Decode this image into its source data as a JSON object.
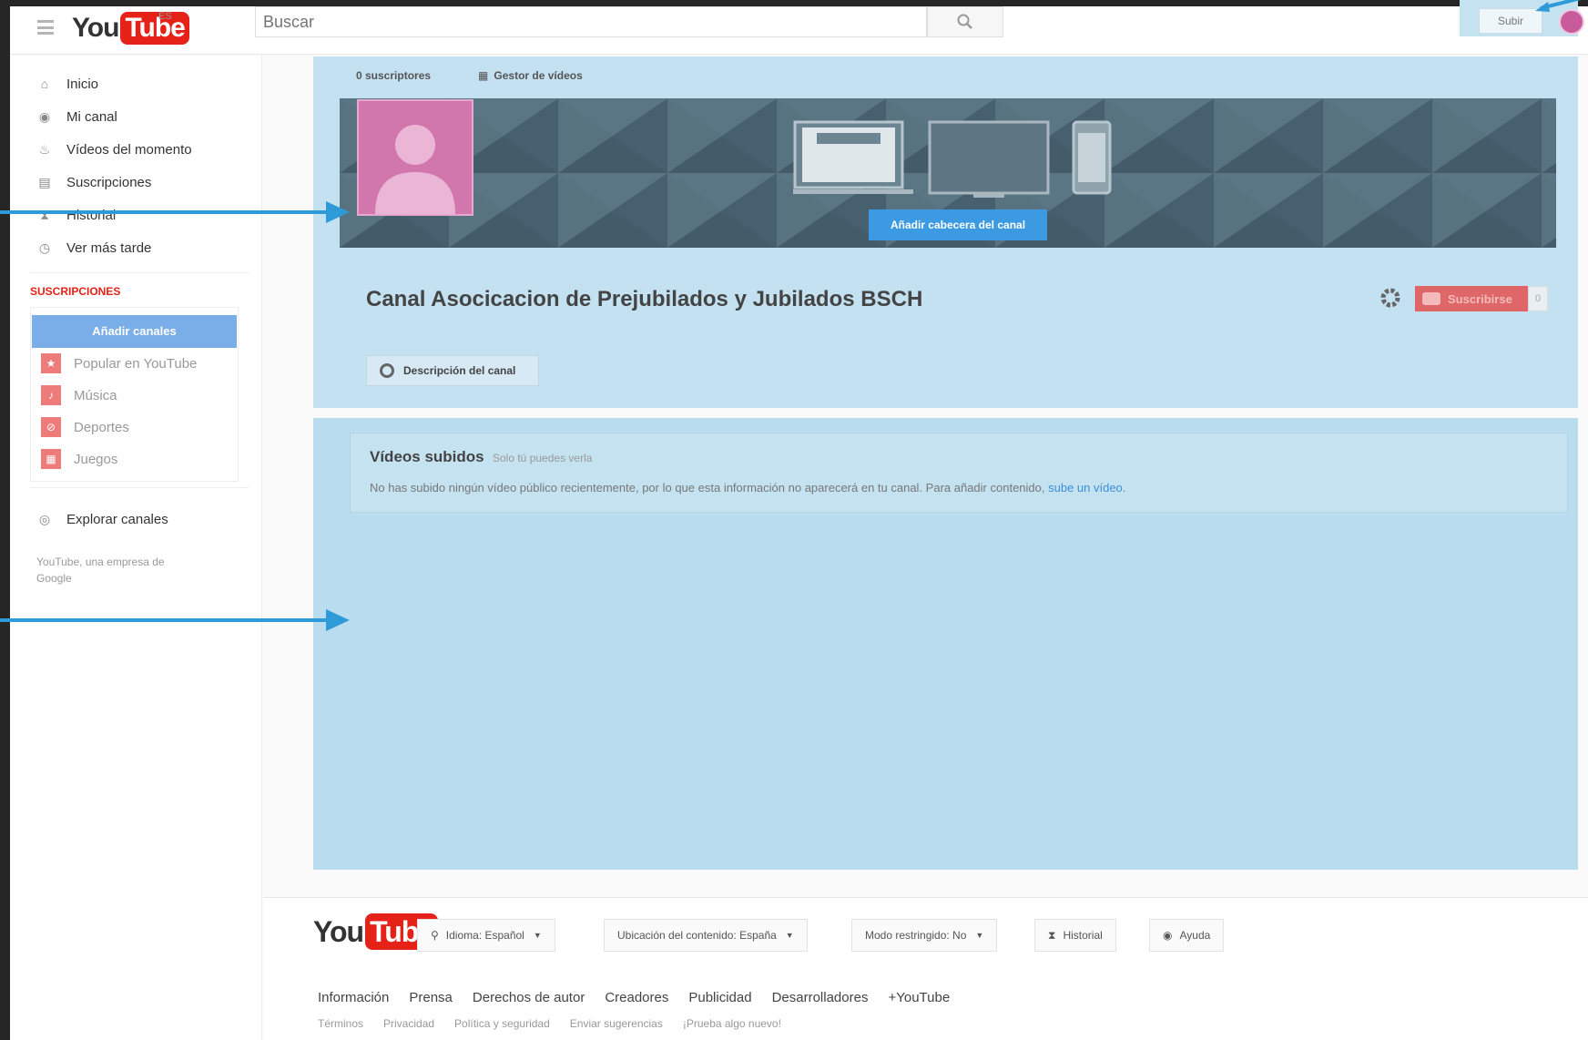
{
  "header": {
    "logo_you": "You",
    "logo_tube": "Tube",
    "locale": "ES",
    "search_placeholder": "Buscar",
    "upload_label": "Subir"
  },
  "sidebar": {
    "nav": [
      {
        "label": "Inicio",
        "icon": "home-icon"
      },
      {
        "label": "Mi canal",
        "icon": "user-icon"
      },
      {
        "label": "Vídeos del momento",
        "icon": "flame-icon"
      },
      {
        "label": "Suscripciones",
        "icon": "subscriptions-icon"
      },
      {
        "label": "Historial",
        "icon": "hourglass-icon"
      },
      {
        "label": "Ver más tarde",
        "icon": "clock-icon"
      }
    ],
    "subscriptions_header": "SUSCRIPCIONES",
    "add_channels_label": "Añadir canales",
    "subscriptions": [
      {
        "label": "Popular en YouTube",
        "icon": "star-icon"
      },
      {
        "label": "Música",
        "icon": "music-icon"
      },
      {
        "label": "Deportes",
        "icon": "sports-icon"
      },
      {
        "label": "Juegos",
        "icon": "gamepad-icon"
      }
    ],
    "explore_label": "Explorar canales",
    "footer_text": "YouTube, una empresa de Google"
  },
  "channel": {
    "tabs": {
      "subscribers": "0 suscriptores",
      "video_manager": "Gestor de vídeos"
    },
    "add_header_label": "Añadir cabecera del canal",
    "title": "Canal Asocicacion de Prejubilados y Jubilados BSCH",
    "subscribe_label": "Suscribirse",
    "subscriber_count": "0",
    "description_label": "Descripción del canal",
    "uploaded_title": "Vídeos subidos",
    "uploaded_visibility": "Solo tú puedes verla",
    "uploaded_message": "No has subido ningún vídeo público recientemente, por lo que esta información no aparecerá en tu canal. Para añadir contenido, ",
    "uploaded_link": "sube un vídeo",
    "uploaded_end": "."
  },
  "footer": {
    "language": "Idioma: Español",
    "location": "Ubicación del contenido: España",
    "restricted": "Modo restringido: No",
    "history": "Historial",
    "help": "Ayuda",
    "links": [
      "Información",
      "Prensa",
      "Derechos de autor",
      "Creadores",
      "Publicidad",
      "Desarrolladores",
      "+YouTube"
    ],
    "sublinks": [
      "Términos",
      "Privacidad",
      "Política y seguridad",
      "Enviar sugerencias",
      "¡Prueba algo nuevo!"
    ]
  },
  "colors": {
    "highlight": "#c4e1f1",
    "arrow": "#2f9ad8",
    "youtube_red": "#e62117"
  }
}
